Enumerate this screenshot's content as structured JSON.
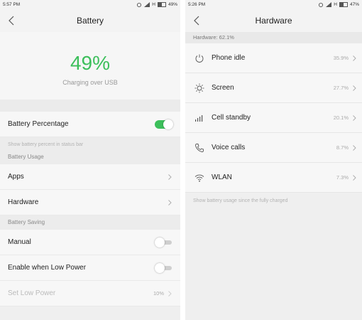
{
  "left": {
    "status": {
      "time": "5:57 PM",
      "signal": "H",
      "battery": "49%",
      "battery_level": 0.49
    },
    "title": "Battery",
    "percent": "49%",
    "charging_text": "Charging over USB",
    "battery_percentage": {
      "label": "Battery Percentage",
      "enabled": true
    },
    "battery_percentage_hint": "Show battery percent in status bar",
    "usage_header": "Battery Usage",
    "apps_label": "Apps",
    "hardware_label": "Hardware",
    "saving_header": "Battery Saving",
    "manual": {
      "label": "Manual",
      "enabled": false
    },
    "low_power": {
      "label": "Enable when Low Power",
      "enabled": false
    },
    "set_low_power": {
      "label": "Set Low Power",
      "value": "10%"
    },
    "colors": {
      "accent": "#3cbf5b"
    }
  },
  "right": {
    "status": {
      "time": "5:26 PM",
      "signal": "H",
      "battery": "47%",
      "battery_level": 0.47
    },
    "title": "Hardware",
    "summary": "Hardware: 62.1%",
    "items": [
      {
        "icon": "power-icon",
        "label": "Phone idle",
        "value": "35.9%"
      },
      {
        "icon": "brightness-icon",
        "label": "Screen",
        "value": "27.7%"
      },
      {
        "icon": "signal-bars-icon",
        "label": "Cell standby",
        "value": "20.1%"
      },
      {
        "icon": "phone-icon",
        "label": "Voice calls",
        "value": "8.7%"
      },
      {
        "icon": "wifi-icon",
        "label": "WLAN",
        "value": "7.3%"
      }
    ],
    "hint": "Show battery usage since the fully charged"
  }
}
